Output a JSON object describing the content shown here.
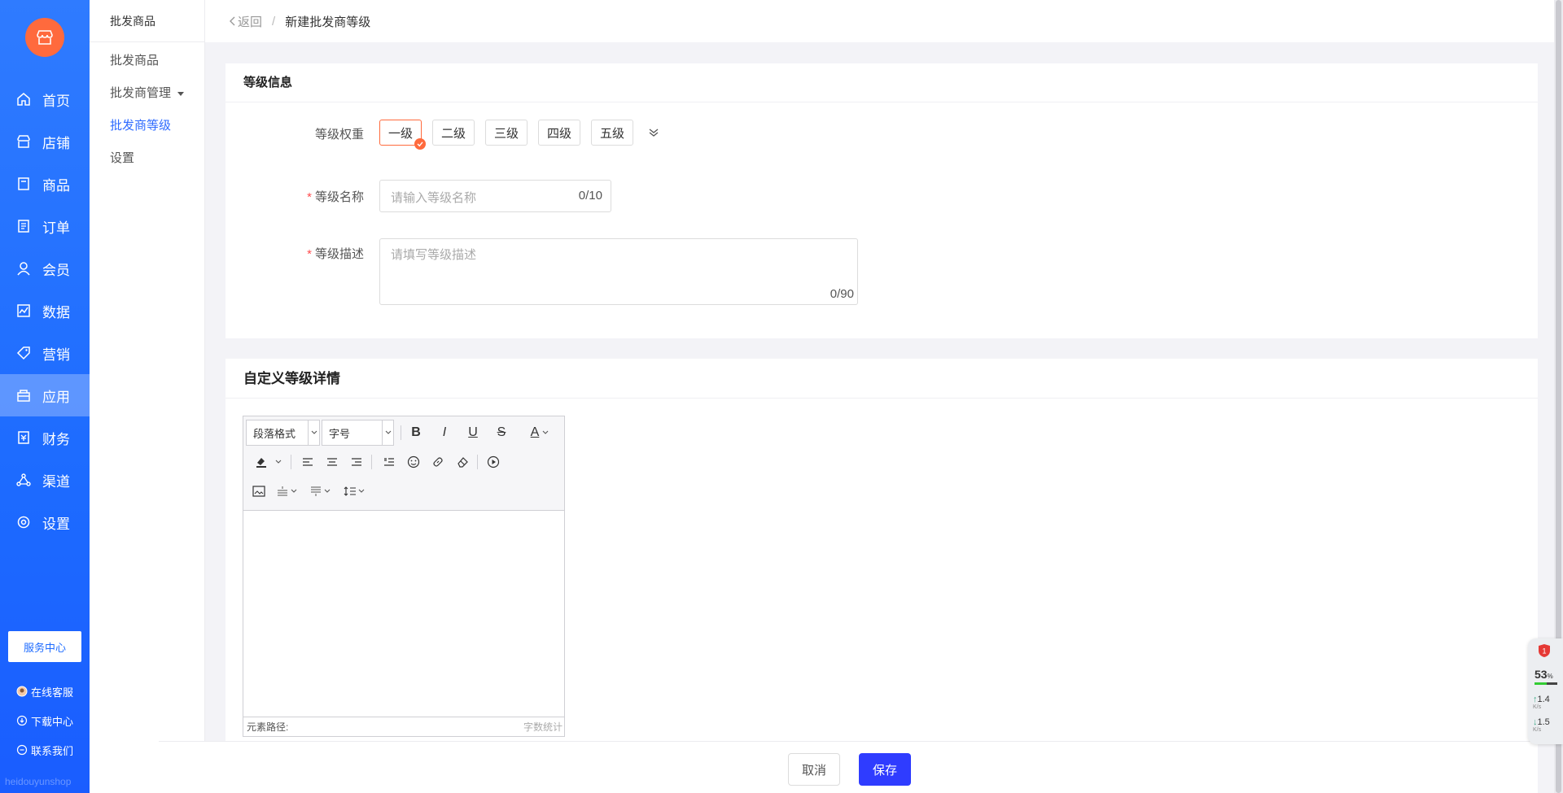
{
  "sidebar": {
    "items": [
      {
        "label": "首页",
        "icon": "home-icon"
      },
      {
        "label": "店铺",
        "icon": "store-icon"
      },
      {
        "label": "商品",
        "icon": "goods-icon"
      },
      {
        "label": "订单",
        "icon": "order-icon"
      },
      {
        "label": "会员",
        "icon": "member-icon"
      },
      {
        "label": "数据",
        "icon": "chart-icon"
      },
      {
        "label": "营销",
        "icon": "tag-icon"
      },
      {
        "label": "应用",
        "icon": "app-icon"
      },
      {
        "label": "财务",
        "icon": "finance-icon"
      },
      {
        "label": "渠道",
        "icon": "channel-icon"
      },
      {
        "label": "设置",
        "icon": "gear-icon"
      }
    ],
    "service_center": "服务中心",
    "bottom_links": [
      "在线客服",
      "下载中心",
      "联系我们"
    ],
    "watermark": "heidouyunshop"
  },
  "subnav": {
    "title": "批发商品",
    "items": [
      "批发商品",
      "批发商管理",
      "批发商等级",
      "设置"
    ]
  },
  "header": {
    "back": "返回",
    "current": "新建批发商等级"
  },
  "level_info": {
    "title": "等级信息",
    "weight_label": "等级权重",
    "levels": [
      "一级",
      "二级",
      "三级",
      "四级",
      "五级"
    ],
    "selected_level": "一级",
    "name_label": "等级名称",
    "name_placeholder": "请输入等级名称",
    "name_counter": "0/10",
    "desc_label": "等级描述",
    "desc_placeholder": "请填写等级描述",
    "desc_counter": "0/90"
  },
  "details": {
    "title": "自定义等级详情",
    "paragraph_format": "段落格式",
    "font_size": "字号",
    "path_label": "元素路径:",
    "word_count": "字数统计"
  },
  "footer": {
    "cancel": "取消",
    "save": "保存"
  },
  "widget": {
    "badge": "1",
    "cpu": "53",
    "cpu_unit": "%",
    "up": "1.4",
    "down": "1.5",
    "unit": "K/s"
  },
  "colors": {
    "sidebar": "#1d6bff",
    "accent_orange": "#ff6a3d",
    "primary": "#2f3cff",
    "active_link": "#2f6bff"
  }
}
